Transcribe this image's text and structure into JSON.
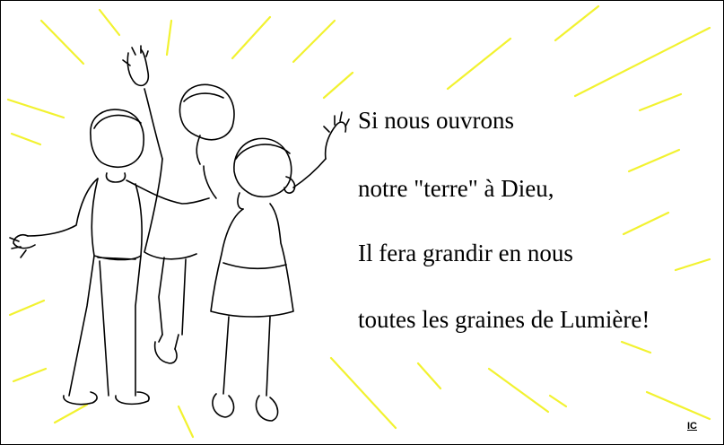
{
  "poem": {
    "lines": [
      "Si nous ouvrons",
      "notre \"terre\" à Dieu,",
      "Il fera grandir en nous",
      "toutes les graines de Lumière!"
    ]
  },
  "credit": "IC",
  "colors": {
    "rays": "#f2f230",
    "ink": "#000000",
    "background": "#ffffff"
  },
  "illustration": {
    "subject": "children-with-raised-hands",
    "icon": "children-praising-icon"
  }
}
